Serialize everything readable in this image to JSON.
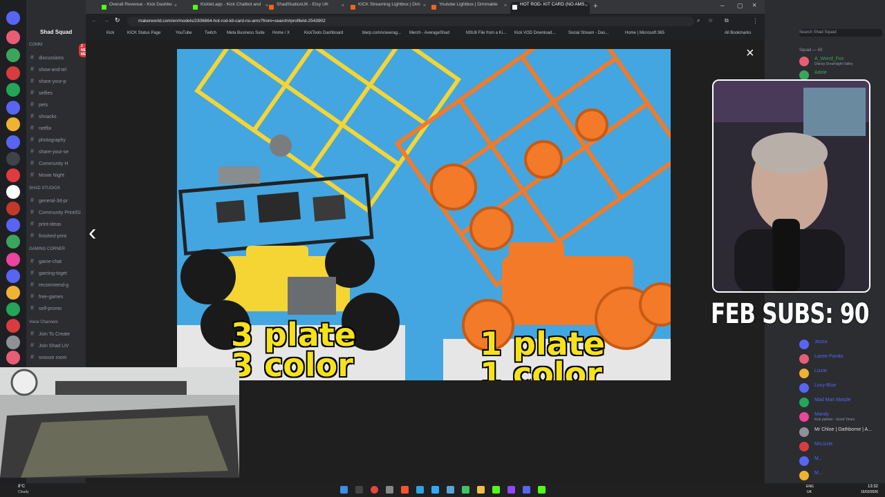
{
  "discord": {
    "server_name": "Shad Squad",
    "new_mentions_badge": "2 NEW MENT",
    "channels": [
      {
        "label": "COMM",
        "type": "cat"
      },
      {
        "label": "discussions",
        "type": "text"
      },
      {
        "label": "show-and-tel",
        "type": "text"
      },
      {
        "label": "share-your-p",
        "type": "text"
      },
      {
        "label": "selfies",
        "type": "text"
      },
      {
        "label": "pets",
        "type": "text"
      },
      {
        "label": "shnacks",
        "type": "text"
      },
      {
        "label": "netflix",
        "type": "text"
      },
      {
        "label": "photography",
        "type": "text"
      },
      {
        "label": "share-your-se",
        "type": "text"
      },
      {
        "label": "Community H",
        "type": "text"
      },
      {
        "label": "Movie Night",
        "type": "text"
      },
      {
        "label": "SHAD STUDIOS",
        "type": "cat"
      },
      {
        "label": "general-3d-pr",
        "type": "text"
      },
      {
        "label": "Community Print/Gi",
        "type": "text"
      },
      {
        "label": "print-ideas",
        "type": "text"
      },
      {
        "label": "finished-print",
        "type": "text"
      },
      {
        "label": "GAMING CORNER",
        "type": "cat"
      },
      {
        "label": "game-chat",
        "type": "text"
      },
      {
        "label": "gaming-toget",
        "type": "text"
      },
      {
        "label": "recommend-g",
        "type": "text"
      },
      {
        "label": "free-games",
        "type": "text"
      },
      {
        "label": "self-promo",
        "type": "text"
      },
      {
        "label": "Voice Channels",
        "type": "cat"
      },
      {
        "label": "Join To Create",
        "type": "text"
      },
      {
        "label": "Join Shad LIV",
        "type": "text"
      },
      {
        "label": "snooze room",
        "type": "text"
      }
    ],
    "search_placeholder": "Search Shad Squad",
    "members_header": "Squad — 43",
    "members": [
      {
        "name": "A_Weird_Fox",
        "status": "Disney Dreamlight Valley",
        "color": "#3ba55c"
      },
      {
        "name": "Adele",
        "status": "",
        "color": "#3ba55c"
      },
      {
        "name": "Jezza",
        "status": "",
        "color": "#5865f2"
      },
      {
        "name": "Lazee Panda",
        "status": "",
        "color": "#5865f2"
      },
      {
        "name": "Lizzie",
        "status": "",
        "color": "#5865f2"
      },
      {
        "name": "Lucy-Blue",
        "status": "",
        "color": "#5865f2"
      },
      {
        "name": "Mad Man Marple",
        "status": "",
        "color": "#5865f2"
      },
      {
        "name": "Mandy",
        "status": "Kick partner · Good Times",
        "color": "#5865f2"
      },
      {
        "name": "Mr Chloe | Oathborne | A...",
        "status": "",
        "color": "#dbdee1"
      },
      {
        "name": "MrLizzie",
        "status": "",
        "color": "#5865f2"
      },
      {
        "name": "M...",
        "status": "",
        "color": "#5865f2"
      },
      {
        "name": "M...",
        "status": "",
        "color": "#5865f2"
      }
    ]
  },
  "browser": {
    "tabs": [
      {
        "label": "Overall Revenue - Kick Dashbo",
        "color": "#53fc18"
      },
      {
        "label": "Kicklet.app - Kick Chatbot and",
        "color": "#53fc18"
      },
      {
        "label": "ShadStudiosUK - Etsy UK",
        "color": "#f1641e"
      },
      {
        "label": "KICK Streaming Lightbox | Dim",
        "color": "#f1641e"
      },
      {
        "label": "Youtube Lightbox | Dimmable",
        "color": "#f1641e"
      },
      {
        "label": "HOT ROD- KIT CARD (NO AMS",
        "color": "#ffffff"
      }
    ],
    "url": "makerworld.com/en/models/2306664-hot-rod-kit-card-no-ams?from=search#profileId-2543902",
    "bookmarks": [
      "Kick",
      "KICK Status Page",
      "YouTube",
      "Twitch",
      "Meta Business Suite",
      "Home / X",
      "KickTools Dashboard",
      "blerp.com/x/averag...",
      "Merch - AverageShad",
      "M3U8 File from a Ki...",
      "Kick VOD Download...",
      "Social Stream - Das...",
      "Home | Microsoft 365",
      "All Bookmarks"
    ],
    "close_icon": "×",
    "prev_icon": "‹"
  },
  "photo": {
    "left_caption_line1": "3 plate",
    "left_caption_line2": "3 color",
    "right_caption_line1": "1 plate",
    "right_caption_line2": "1 color",
    "left_kit_color": "#f5d534",
    "right_kit_color": "#f27a28",
    "background_color": "#43a6e0"
  },
  "overlay": {
    "subs_text": "FEB SUBS: 90"
  },
  "taskbar": {
    "weather_temp": "8°C",
    "weather_desc": "Cloudy",
    "lang": "ENG",
    "region": "UK",
    "time": "13:32",
    "date": "16/02/2026"
  }
}
